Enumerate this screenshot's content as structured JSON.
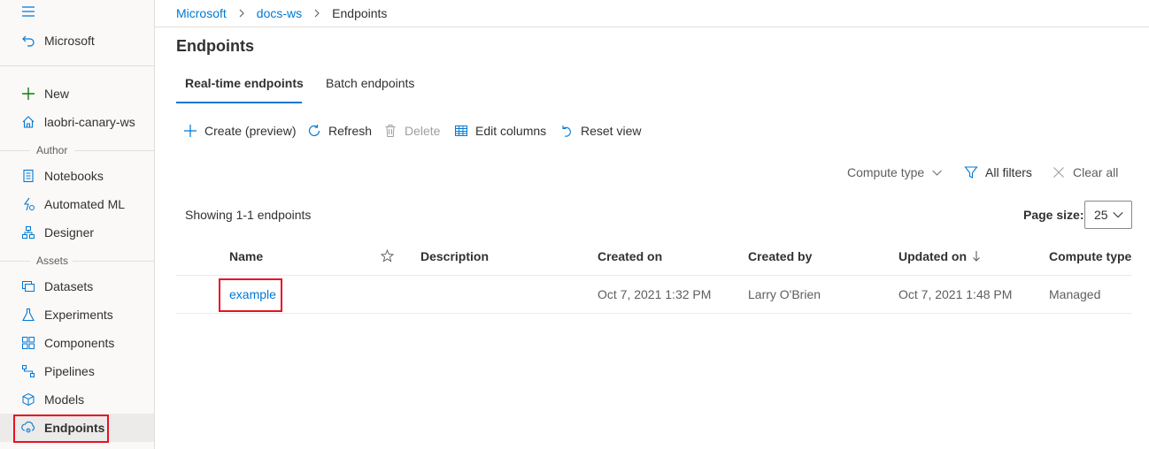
{
  "sidebar": {
    "back_label": "Microsoft",
    "items_top": [
      {
        "label": "New"
      },
      {
        "label": "laobri-canary-ws"
      }
    ],
    "author_section": "Author",
    "author_items": [
      {
        "label": "Notebooks"
      },
      {
        "label": "Automated ML"
      },
      {
        "label": "Designer"
      }
    ],
    "assets_section": "Assets",
    "asset_items": [
      {
        "label": "Datasets"
      },
      {
        "label": "Experiments"
      },
      {
        "label": "Components"
      },
      {
        "label": "Pipelines"
      },
      {
        "label": "Models"
      },
      {
        "label": "Endpoints"
      }
    ]
  },
  "breadcrumb": {
    "items": [
      "Microsoft",
      "docs-ws"
    ],
    "current": "Endpoints"
  },
  "page_title": "Endpoints",
  "tabs": [
    {
      "label": "Real-time endpoints",
      "active": true
    },
    {
      "label": "Batch endpoints",
      "active": false
    }
  ],
  "toolbar": {
    "create": "Create (preview)",
    "refresh": "Refresh",
    "delete": "Delete",
    "edit_columns": "Edit columns",
    "reset_view": "Reset view"
  },
  "filters": {
    "compute_type": "Compute type",
    "all_filters": "All filters",
    "clear_all": "Clear all"
  },
  "table": {
    "showing": "Showing 1-1 endpoints",
    "page_size_label": "Page size:",
    "page_size_value": "25",
    "columns": {
      "name": "Name",
      "description": "Description",
      "created_on": "Created on",
      "created_by": "Created by",
      "updated_on": "Updated on",
      "compute_type": "Compute type"
    },
    "rows": [
      {
        "name": "example",
        "description": "",
        "created_on": "Oct 7, 2021 1:32 PM",
        "created_by": "Larry O'Brien",
        "updated_on": "Oct 7, 2021 1:48 PM",
        "compute_type": "Managed"
      }
    ]
  },
  "colors": {
    "accent": "#0078d4",
    "highlight": "#e81123",
    "icon_green": "#107c10"
  }
}
